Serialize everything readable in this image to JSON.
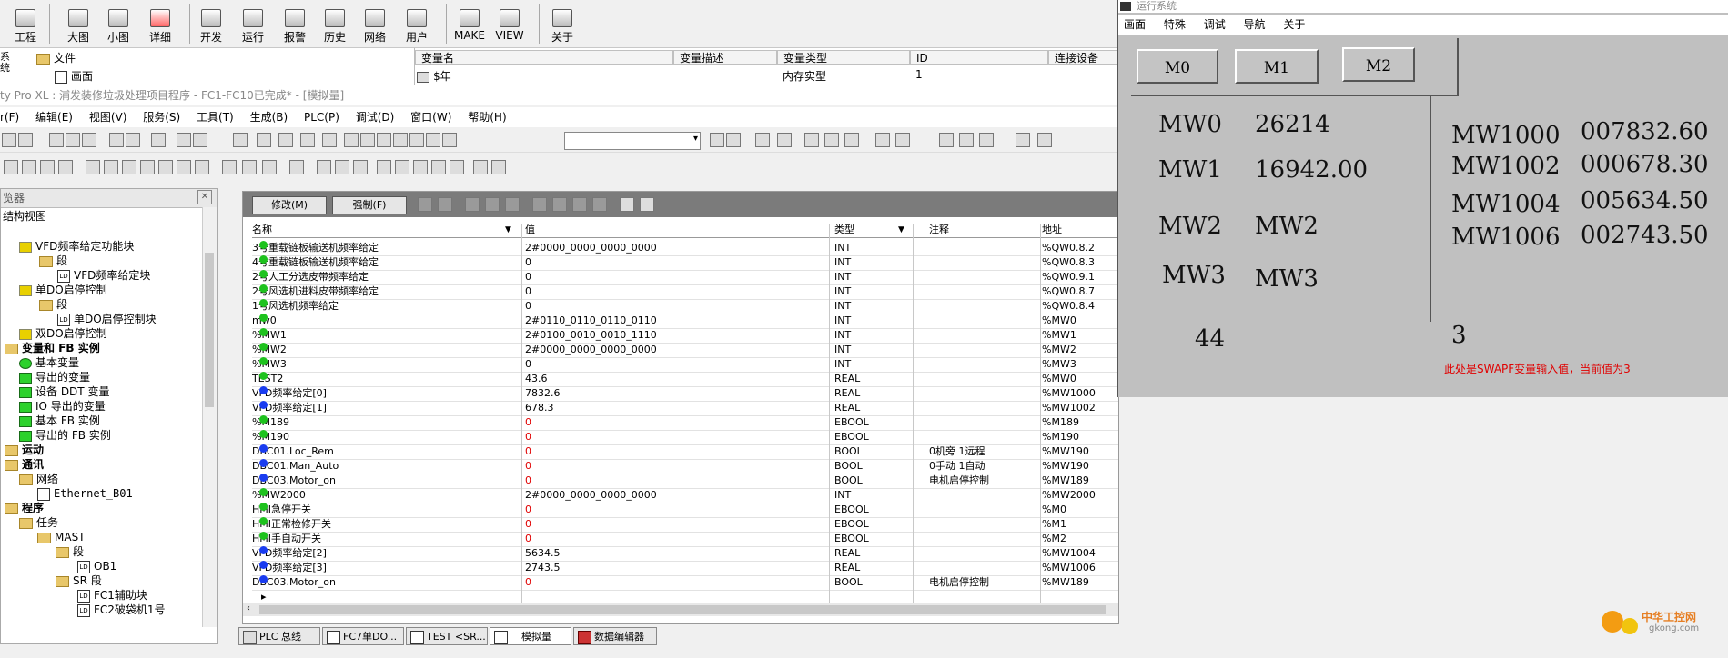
{
  "top_toolbar": {
    "buttons": [
      {
        "label": "工程",
        "icon": "project-icon"
      },
      {
        "label": "大图",
        "icon": "large-icons-icon"
      },
      {
        "label": "小图",
        "icon": "small-icons-icon"
      },
      {
        "label": "详细",
        "icon": "details-icon"
      },
      {
        "label": "开发",
        "icon": "develop-icon"
      },
      {
        "label": "运行",
        "icon": "run-icon"
      },
      {
        "label": "报警",
        "icon": "alarm-icon"
      },
      {
        "label": "历史",
        "icon": "history-icon"
      },
      {
        "label": "网络",
        "icon": "network-icon"
      },
      {
        "label": "用户",
        "icon": "user-icon"
      },
      {
        "label": "MAKE",
        "icon": "make-icon"
      },
      {
        "label": "VIEW",
        "icon": "view-icon"
      },
      {
        "label": "关于",
        "icon": "about-icon"
      }
    ]
  },
  "browser_top": {
    "side_label": "系统",
    "items": [
      "文件",
      "画面"
    ]
  },
  "var_table_top": {
    "headers": [
      "变量名",
      "变量描述",
      "变量类型",
      "ID",
      "连接设备"
    ],
    "row": {
      "name": "$年",
      "desc": "",
      "type": "内存实型",
      "id": "1",
      "device": ""
    }
  },
  "title_bar": "ty Pro XL : 浦发装修垃圾处理项目程序 - FC1-FC10已完成* - [模拟量]",
  "menu_bar": [
    "r(F)",
    "编辑(E)",
    "视图(V)",
    "服务(S)",
    "工具(T)",
    "生成(B)",
    "PLC(P)",
    "调试(D)",
    "窗口(W)",
    "帮助(H)"
  ],
  "tree": {
    "header": "览器",
    "subheader": "结构视图",
    "items": [
      {
        "label": "VFD频率给定功能块",
        "kind": "block"
      },
      {
        "label": "段",
        "kind": "folder"
      },
      {
        "label": "VFD频率给定块",
        "kind": "ld"
      },
      {
        "label": "单DO启停控制",
        "kind": "block"
      },
      {
        "label": "段",
        "kind": "folder"
      },
      {
        "label": "单DO启停控制块",
        "kind": "ld"
      },
      {
        "label": "双DO启停控制",
        "kind": "block"
      },
      {
        "label": "变量和 FB 实例",
        "kind": "folder-bold"
      },
      {
        "label": "基本变量",
        "kind": "var"
      },
      {
        "label": "导出的变量",
        "kind": "var"
      },
      {
        "label": "设备 DDT 变量",
        "kind": "var"
      },
      {
        "label": "IO 导出的变量",
        "kind": "var"
      },
      {
        "label": "基本 FB 实例",
        "kind": "var"
      },
      {
        "label": "导出的 FB 实例",
        "kind": "var"
      },
      {
        "label": "运动",
        "kind": "folder-bold"
      },
      {
        "label": "通讯",
        "kind": "folder-bold"
      },
      {
        "label": "网络",
        "kind": "folder"
      },
      {
        "label": "Ethernet_B01",
        "kind": "net"
      },
      {
        "label": "程序",
        "kind": "folder-bold"
      },
      {
        "label": "任务",
        "kind": "folder"
      },
      {
        "label": "MAST",
        "kind": "folder"
      },
      {
        "label": "段",
        "kind": "folder"
      },
      {
        "label": "OB1",
        "kind": "ld"
      },
      {
        "label": "SR 段",
        "kind": "folder"
      },
      {
        "label": "FC1辅助块",
        "kind": "ld"
      },
      {
        "label": "FC2破袋机1号",
        "kind": "ld"
      }
    ]
  },
  "anim_table": {
    "modify_label": "修改(M)",
    "force_label": "强制(F)",
    "headers": [
      "名称",
      "值",
      "类型",
      "注释",
      "地址"
    ],
    "rows": [
      {
        "name": "3号重载链板输送机频率给定",
        "value": "2#0000_0000_0000_0000",
        "type": "INT",
        "comment": "",
        "addr": "%QW0.8.2",
        "dot": "green",
        "red": false
      },
      {
        "name": "4号重载链板输送机频率给定",
        "value": "0",
        "type": "INT",
        "comment": "",
        "addr": "%QW0.8.3",
        "dot": "green",
        "red": false
      },
      {
        "name": "2号人工分选皮带频率给定",
        "value": "0",
        "type": "INT",
        "comment": "",
        "addr": "%QW0.9.1",
        "dot": "green",
        "red": false
      },
      {
        "name": "2号风选机进料皮带频率给定",
        "value": "0",
        "type": "INT",
        "comment": "",
        "addr": "%QW0.8.7",
        "dot": "green",
        "red": false
      },
      {
        "name": "1号风选机频率给定",
        "value": "0",
        "type": "INT",
        "comment": "",
        "addr": "%QW0.8.4",
        "dot": "green",
        "red": false
      },
      {
        "name": "mw0",
        "value": "2#0110_0110_0110_0110",
        "type": "INT",
        "comment": "",
        "addr": "%MW0",
        "dot": "green",
        "red": false
      },
      {
        "name": "%MW1",
        "value": "2#0100_0010_0010_1110",
        "type": "INT",
        "comment": "",
        "addr": "%MW1",
        "dot": "green",
        "red": false
      },
      {
        "name": "%MW2",
        "value": "2#0000_0000_0000_0000",
        "type": "INT",
        "comment": "",
        "addr": "%MW2",
        "dot": "green",
        "red": false
      },
      {
        "name": "%MW3",
        "value": "0",
        "type": "INT",
        "comment": "",
        "addr": "%MW3",
        "dot": "green",
        "red": false
      },
      {
        "name": "TEST2",
        "value": "43.6",
        "type": "REAL",
        "comment": "",
        "addr": "%MW0",
        "dot": "green",
        "red": false
      },
      {
        "name": "VFD频率给定[0]",
        "value": "7832.6",
        "type": "REAL",
        "comment": "",
        "addr": "%MW1000",
        "dot": "blue",
        "red": false
      },
      {
        "name": "VFD频率给定[1]",
        "value": "678.3",
        "type": "REAL",
        "comment": "",
        "addr": "%MW1002",
        "dot": "blue",
        "red": false
      },
      {
        "name": "%M189",
        "value": "0",
        "type": "EBOOL",
        "comment": "",
        "addr": "%M189",
        "dot": "green",
        "red": true
      },
      {
        "name": "%M190",
        "value": "0",
        "type": "EBOOL",
        "comment": "",
        "addr": "%M190",
        "dot": "green",
        "red": true
      },
      {
        "name": "DBC01.Loc_Rem",
        "value": "0",
        "type": "BOOL",
        "comment": "0机旁 1远程",
        "addr": "%MW190",
        "dot": "blue",
        "red": true
      },
      {
        "name": "DBC01.Man_Auto",
        "value": "0",
        "type": "BOOL",
        "comment": "0手动 1自动",
        "addr": "%MW190",
        "dot": "blue",
        "red": true
      },
      {
        "name": "DBC03.Motor_on",
        "value": "0",
        "type": "BOOL",
        "comment": "电机启停控制",
        "addr": "%MW189",
        "dot": "blue",
        "red": true
      },
      {
        "name": "%MW2000",
        "value": "2#0000_0000_0000_0000",
        "type": "INT",
        "comment": "",
        "addr": "%MW2000",
        "dot": "green",
        "red": false
      },
      {
        "name": "HMI急停开关",
        "value": "0",
        "type": "EBOOL",
        "comment": "",
        "addr": "%M0",
        "dot": "green",
        "red": true
      },
      {
        "name": "HMI正常检修开关",
        "value": "0",
        "type": "EBOOL",
        "comment": "",
        "addr": "%M1",
        "dot": "green",
        "red": true
      },
      {
        "name": "HMI手自动开关",
        "value": "0",
        "type": "EBOOL",
        "comment": "",
        "addr": "%M2",
        "dot": "green",
        "red": true
      },
      {
        "name": "VFD频率给定[2]",
        "value": "5634.5",
        "type": "REAL",
        "comment": "",
        "addr": "%MW1004",
        "dot": "blue",
        "red": false
      },
      {
        "name": "VFD频率给定[3]",
        "value": "2743.5",
        "type": "REAL",
        "comment": "",
        "addr": "%MW1006",
        "dot": "blue",
        "red": false
      },
      {
        "name": "DBC03.Motor_on",
        "value": "0",
        "type": "BOOL",
        "comment": "电机启停控制",
        "addr": "%MW189",
        "dot": "blue",
        "red": true
      }
    ]
  },
  "bottom_tabs": [
    "PLC 总线",
    "FC7单DO...",
    "TEST <SR...",
    "模拟量",
    "数据编辑器"
  ],
  "runtime": {
    "title": "运行系统",
    "menu": [
      "画面",
      "特殊",
      "调试",
      "导航",
      "关于"
    ],
    "buttons": [
      "M0",
      "M1",
      "M2"
    ],
    "left_rows": [
      {
        "label": "MW0",
        "value": "26214"
      },
      {
        "label": "MW1",
        "value": "16942.00"
      },
      {
        "label": "MW2",
        "value": "MW2"
      },
      {
        "label": "MW3",
        "value": "MW3"
      }
    ],
    "right_rows": [
      {
        "label": "MW1000",
        "value": "007832.60"
      },
      {
        "label": "MW1002",
        "value": "000678.30"
      },
      {
        "label": "MW1004",
        "value": "005634.50"
      },
      {
        "label": "MW1006",
        "value": "002743.50"
      }
    ],
    "bottom_left_value": "44",
    "bottom_right_value": "3",
    "note": "此处是SWAPF变量输入值，当前值为3"
  },
  "watermark": {
    "text": "中华工控网",
    "url": "gkong.com"
  }
}
